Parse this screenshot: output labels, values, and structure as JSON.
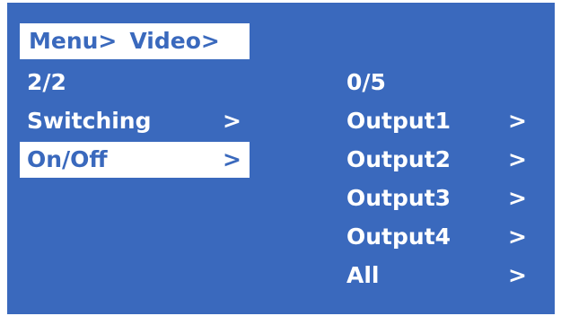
{
  "menu": {
    "breadcrumb": [
      "Menu>",
      "Video>"
    ],
    "page_indicator": "2/2",
    "items": [
      {
        "label": "Switching",
        "arrow": ">",
        "selected": false
      },
      {
        "label": "On/Off",
        "arrow": ">",
        "selected": true
      }
    ]
  },
  "submenu": {
    "index_indicator": "0/5",
    "items": [
      {
        "label": "Output1",
        "arrow": ">"
      },
      {
        "label": "Output2",
        "arrow": ">"
      },
      {
        "label": "Output3",
        "arrow": ">"
      },
      {
        "label": "Output4",
        "arrow": ">"
      },
      {
        "label": "All",
        "arrow": ">"
      }
    ]
  },
  "colors": {
    "background": "#3a69bd",
    "highlight": "#ffffff",
    "text": "#ffffff"
  }
}
